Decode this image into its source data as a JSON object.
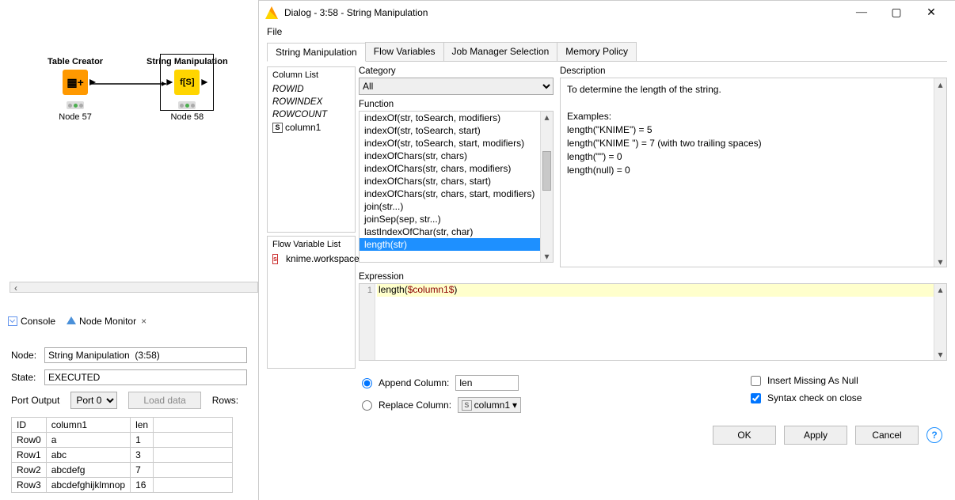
{
  "canvas": {
    "nodes": [
      {
        "title": "Table Creator",
        "id": "Node 57",
        "glyph": "grid-plus"
      },
      {
        "title": "String Manipulation",
        "id": "Node 58",
        "glyph": "f[S]"
      }
    ]
  },
  "lower": {
    "tabs": [
      {
        "label": "Console"
      },
      {
        "label": "Node Monitor"
      }
    ],
    "node_label": "Node:",
    "node_value": "String Manipulation  (3:58)",
    "state_label": "State:",
    "state_value": "EXECUTED",
    "port_output_label": "Port Output",
    "port_select": "Port 0",
    "load_btn": "Load data",
    "rows_label": "Rows:",
    "table": {
      "headers": [
        "ID",
        "column1",
        "len"
      ],
      "rows": [
        [
          "Row0",
          "a",
          "1"
        ],
        [
          "Row1",
          "abc",
          "3"
        ],
        [
          "Row2",
          "abcdefg",
          "7"
        ],
        [
          "Row3",
          "abcdefghijklmnop",
          "16"
        ]
      ]
    }
  },
  "dialog": {
    "title": "Dialog - 3:58 - String Manipulation",
    "menu_file": "File",
    "tabs": [
      "String Manipulation",
      "Flow Variables",
      "Job Manager Selection",
      "Memory Policy"
    ],
    "column_list_title": "Column List",
    "column_list": [
      "ROWID",
      "ROWINDEX",
      "ROWCOUNT"
    ],
    "column_list_plain": "column1",
    "flowvar_title": "Flow Variable List",
    "flowvar_item": "knime.workspace",
    "category_label": "Category",
    "category_value": "All",
    "function_label": "Function",
    "functions": [
      "indexOf(str, toSearch, modifiers)",
      "indexOf(str, toSearch, start)",
      "indexOf(str, toSearch, start, modifiers)",
      "indexOfChars(str, chars)",
      "indexOfChars(str, chars, modifiers)",
      "indexOfChars(str, chars, start)",
      "indexOfChars(str, chars, start, modifiers)",
      "join(str...)",
      "joinSep(sep, str...)",
      "lastIndexOfChar(str, char)",
      "length(str)"
    ],
    "function_selected_index": 10,
    "description_label": "Description",
    "description_lines": [
      "To determine the length of the string.",
      "",
      "Examples:",
      "length(\"KNIME\")    = 5",
      "length(\"KNIME  \") = 7 (with two trailing spaces)",
      "length(\"\")              = 0",
      "length(null)           = 0"
    ],
    "expression_label": "Expression",
    "expression_kw": "length(",
    "expression_col": "$column1$",
    "expression_close": ")",
    "append_label": "Append Column:",
    "append_value": "len",
    "replace_label": "Replace Column:",
    "replace_value": "column1",
    "insert_missing": "Insert Missing As Null",
    "syntax_check": "Syntax check on close",
    "ok": "OK",
    "apply": "Apply",
    "cancel": "Cancel"
  }
}
